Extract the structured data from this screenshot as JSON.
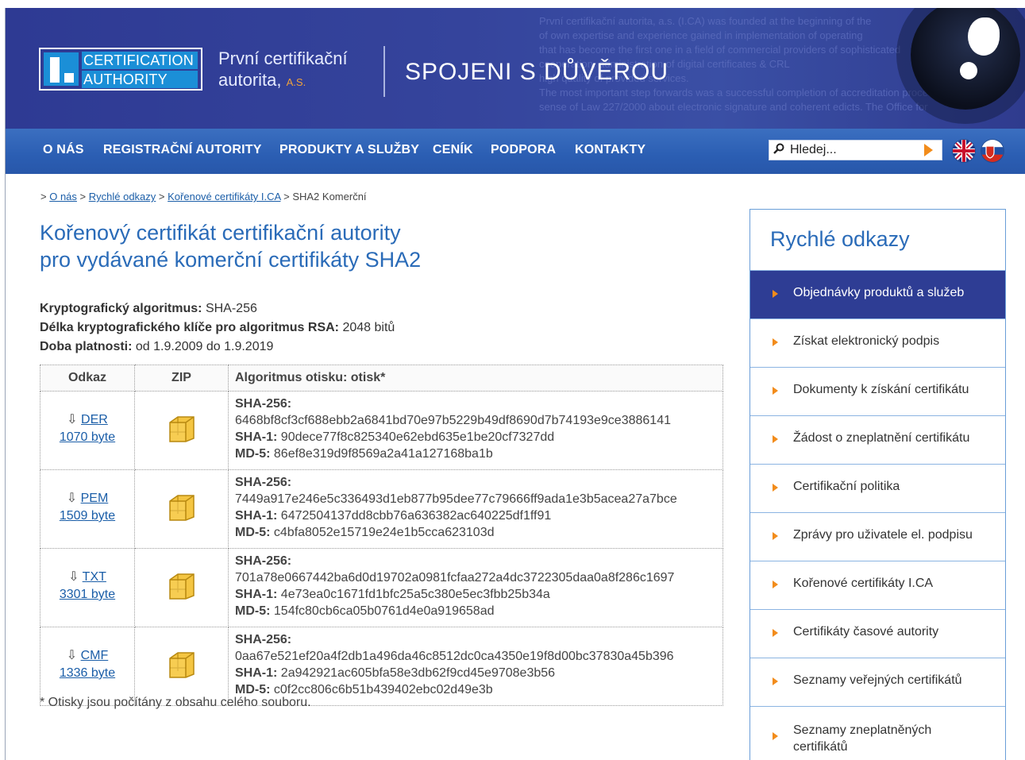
{
  "header": {
    "logo_line1": "CERTIFICATION",
    "logo_line2": "AUTHORITY",
    "company_line1": "První certifikační",
    "company_line2": "autorita,",
    "company_suffix": "A.S.",
    "slogan": "SPOJENI S DŮVĚROU"
  },
  "nav": {
    "items": [
      {
        "label": "O NÁS"
      },
      {
        "label": "REGISTRAČNÍ AUTORITY"
      },
      {
        "label": "PRODUKTY A SLUŽBY"
      },
      {
        "label": "CENÍK"
      },
      {
        "label": "PODPORA"
      },
      {
        "label": "KONTAKTY"
      }
    ],
    "search_placeholder": "Hledej..."
  },
  "breadcrumb": {
    "items": [
      "O nás",
      "Rychlé odkazy",
      "Kořenové certifikáty I.CA"
    ],
    "current": "SHA2 Komerční"
  },
  "page": {
    "title_line1": "Kořenový certifikát certifikační autority",
    "title_line2": "pro vydávané komerční certifikáty SHA2",
    "algorithm_label": "Kryptografický algoritmus:",
    "algorithm_value": "SHA-256",
    "keylength_label": "Délka kryptografického klíče pro algoritmus RSA:",
    "keylength_value": "2048 bitů",
    "validity_label": "Doba platnosti:",
    "validity_value": "od 1.9.2009 do 1.9.2019",
    "footnote": "* Otisky jsou počítány z obsahu celého souboru."
  },
  "table": {
    "headers": [
      "Odkaz",
      "ZIP",
      "Algoritmus otisku: otisk*"
    ],
    "rows": [
      {
        "format": "DER",
        "size": "1070 byte",
        "sha256_label": "SHA-256:",
        "sha256": "6468bf8cf3cf688ebb2a6841bd70e97b5229b49df8690d7b74193e9ce3886141",
        "sha1_label": "SHA-1:",
        "sha1": "90dece77f8c825340e62ebd635e1be20cf7327dd",
        "md5_label": "MD-5:",
        "md5": "86ef8e319d9f8569a2a41a127168ba1b"
      },
      {
        "format": "PEM",
        "size": "1509 byte",
        "sha256_label": "SHA-256:",
        "sha256": "7449a917e246e5c336493d1eb877b95dee77c79666ff9ada1e3b5acea27a7bce",
        "sha1_label": "SHA-1:",
        "sha1": "6472504137dd8cbb76a636382ac640225df1ff91",
        "md5_label": "MD-5:",
        "md5": "c4bfa8052e15719e24e1b5cca623103d"
      },
      {
        "format": "TXT",
        "size": "3301 byte",
        "sha256_label": "SHA-256:",
        "sha256": "701a78e0667442ba6d0d19702a0981fcfaa272a4dc3722305daa0a8f286c1697",
        "sha1_label": "SHA-1:",
        "sha1": "4e73ea0c1671fd1bfc25a5c380e5ec3fbb25b34a",
        "md5_label": "MD-5:",
        "md5": "154fc80cb6ca05b0761d4e0a919658ad"
      },
      {
        "format": "CMF",
        "size": "1336 byte",
        "sha256_label": "SHA-256:",
        "sha256": "0aa67e521ef20a4f2db1a496da46c8512dc0ca4350e19f8d00bc37830a45b396",
        "sha1_label": "SHA-1:",
        "sha1": "2a942921ac605bfa58e3db62f9cd45e9708e3b56",
        "md5_label": "MD-5:",
        "md5": "c0f2cc806c6b51b439402ebc02d49e3b"
      }
    ]
  },
  "sidebar": {
    "title": "Rychlé odkazy",
    "items": [
      {
        "label": "Objednávky produktů a služeb"
      },
      {
        "label": "Získat elektronický podpis"
      },
      {
        "label": "Dokumenty k získání certifikátu"
      },
      {
        "label": "Žádost o zneplatnění certifikátu"
      },
      {
        "label": "Certifikační politika"
      },
      {
        "label": "Zprávy pro uživatele el. podpisu"
      },
      {
        "label": "Kořenové certifikáty I.CA"
      },
      {
        "label": "Certifikáty časové autority"
      },
      {
        "label": "Seznamy veřejných certifikátů"
      },
      {
        "label": "Seznamy zneplatněných certifikátů"
      }
    ]
  },
  "colors": {
    "header_bg": "#2e3a93",
    "nav_bg": "#2b5eb3",
    "accent_orange": "#f28c1b",
    "title_blue": "#2a6bb8",
    "link_blue": "#1b5ea8"
  }
}
